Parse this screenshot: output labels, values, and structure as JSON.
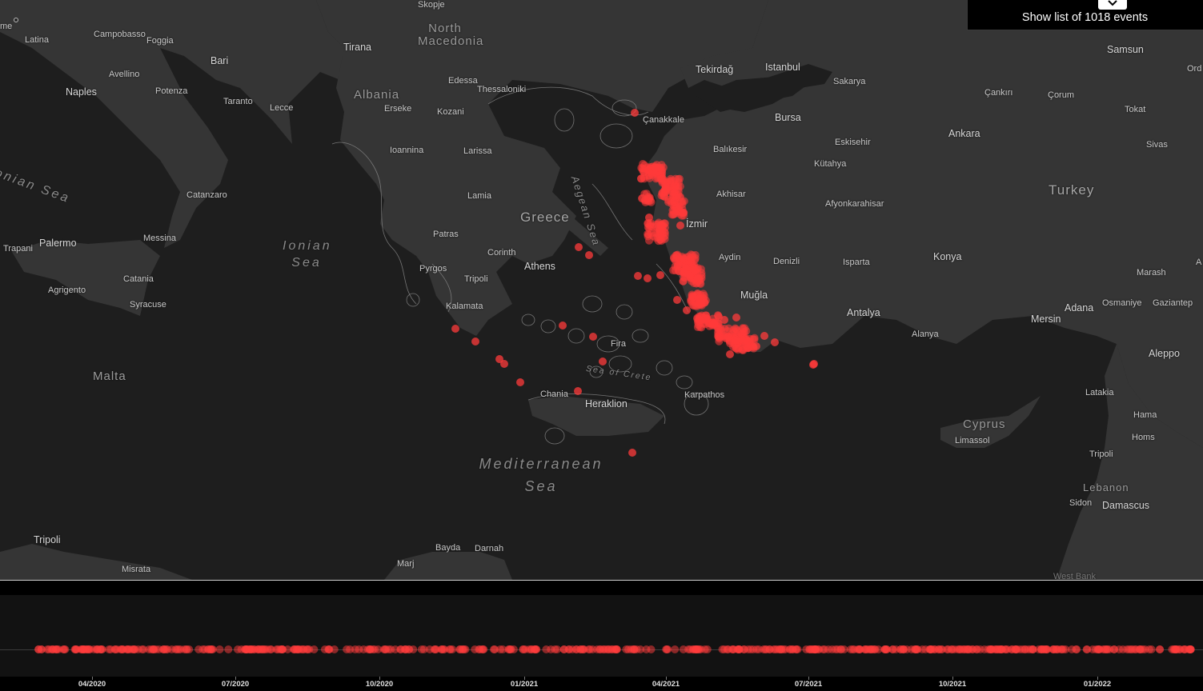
{
  "panel": {
    "label": "Show list of 1018 events"
  },
  "colors": {
    "event": "#ff3b3b",
    "land": "#353535",
    "sea": "#1e1e1e",
    "timeline_bg": "#121212"
  },
  "map": {
    "countries": [
      "Greece",
      "Turkey",
      "Albania",
      "North Macedonia",
      "Malta",
      "Cyprus",
      "Lebanon"
    ],
    "seas": [
      "Ionian Sea",
      "Aegean Sea",
      "Sea of Crete",
      "Mediterranean Sea"
    ],
    "places": {
      "rome": "me",
      "latina": "Latina",
      "campobasso": "Campobasso",
      "foggia": "Foggia",
      "bari": "Bari",
      "naples": "Naples",
      "avellino": "Avellino",
      "potenza": "Potenza",
      "taranto": "Taranto",
      "lecce": "Lecce",
      "catanzaro": "Catanzaro",
      "palermo": "Palermo",
      "trapani": "Trapani",
      "messina": "Messina",
      "agrigento": "Agrigento",
      "catania": "Catania",
      "syracuse": "Syracuse",
      "tripoli_ly": "Tripoli",
      "misrata": "Misrata",
      "bayda": "Bayda",
      "darnah": "Darnah",
      "marj": "Marj",
      "skopje": "Skopje",
      "tirana": "Tirana",
      "edessa": "Edessa",
      "thessaloniki": "Thessaloniki",
      "erseke": "Erseke",
      "kozani": "Kozani",
      "ioannina": "Ioannina",
      "larissa": "Larissa",
      "lamia": "Lamia",
      "patras": "Patras",
      "corinth": "Corinth",
      "athens": "Athens",
      "pyrgos": "Pyrgos",
      "tripoli_gr": "Tripoli",
      "kalamata": "Kalamata",
      "chania": "Chania",
      "heraklion": "Heraklion",
      "fira": "Fira",
      "karpathos": "Karpathos",
      "tekirdag": "Tekirdağ",
      "istanbul": "Istanbul",
      "sakarya": "Sakarya",
      "canakkale": "Çanakkale",
      "bursa": "Bursa",
      "balikesir": "Balıkesir",
      "eskisehir": "Eskisehir",
      "kutahya": "Kütahya",
      "akhisar": "Akhisar",
      "izmir": "İzmir",
      "afyonkarahisar": "Afyonkarahisar",
      "aydin": "Aydin",
      "denizli": "Denizli",
      "isparta": "Isparta",
      "konya": "Konya",
      "mugla": "Muğla",
      "antalya": "Antalya",
      "alanya": "Alanya",
      "mersin": "Mersin",
      "adana": "Adana",
      "osmaniye": "Osmaniye",
      "gaziantep": "Gaziantep",
      "marash": "Marash",
      "samsun": "Samsun",
      "ordu": "Ord",
      "cankiri": "Çankırı",
      "corum": "Çorum",
      "tokat": "Tokat",
      "ankara": "Ankara",
      "sivas": "Sivas",
      "a_edge": "A",
      "aleppo": "Aleppo",
      "latakia": "Latakia",
      "hama": "Hama",
      "homs": "Homs",
      "limassol": "Limassol",
      "tripoli_lb": "Tripoli",
      "sidon": "Sidon",
      "damascus": "Damascus",
      "west_bank": "West Bank"
    }
  },
  "timeline": {
    "ticks": [
      "04/2020",
      "07/2020",
      "10/2020",
      "01/2021",
      "04/2021",
      "07/2021",
      "10/2021",
      "01/2022"
    ]
  }
}
